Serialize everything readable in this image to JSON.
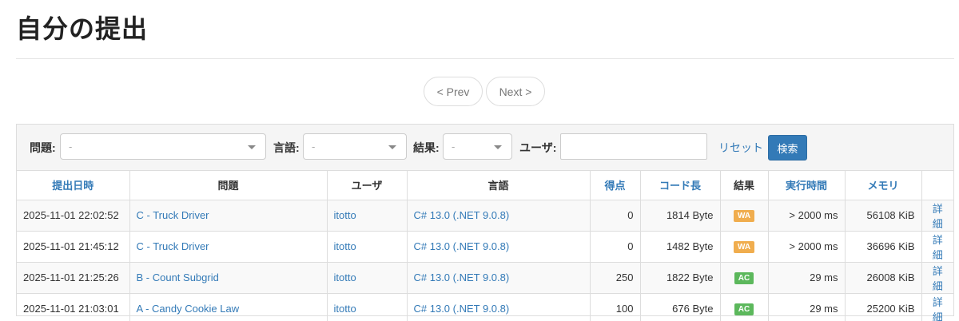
{
  "page": {
    "title": "自分の提出"
  },
  "pager": {
    "prev": "< Prev",
    "next": "Next >"
  },
  "filters": {
    "problem_label": "問題:",
    "problem_value": "-",
    "language_label": "言語:",
    "language_value": "-",
    "status_label": "結果:",
    "status_value": "-",
    "user_label": "ユーザ:",
    "user_value": "",
    "reset": "リセット",
    "search": "検索"
  },
  "table": {
    "headers": [
      "提出日時",
      "問題",
      "ユーザ",
      "言語",
      "得点",
      "コード長",
      "結果",
      "実行時間",
      "メモリ",
      ""
    ],
    "rows": [
      {
        "time": "2025-11-01 22:02:52",
        "problem": "C - Truck Driver",
        "user": "itotto",
        "language": "C# 13.0 (.NET 9.0.8)",
        "score": "0",
        "code_length": "1814 Byte",
        "status": "WA",
        "exec_time": "> 2000 ms",
        "memory": "56108 KiB",
        "detail": "詳細"
      },
      {
        "time": "2025-11-01 21:45:12",
        "problem": "C - Truck Driver",
        "user": "itotto",
        "language": "C# 13.0 (.NET 9.0.8)",
        "score": "0",
        "code_length": "1482 Byte",
        "status": "WA",
        "exec_time": "> 2000 ms",
        "memory": "36696 KiB",
        "detail": "詳細"
      },
      {
        "time": "2025-11-01 21:25:26",
        "problem": "B - Count Subgrid",
        "user": "itotto",
        "language": "C# 13.0 (.NET 9.0.8)",
        "score": "250",
        "code_length": "1822 Byte",
        "status": "AC",
        "exec_time": "29 ms",
        "memory": "26008 KiB",
        "detail": "詳細"
      },
      {
        "time": "2025-11-01 21:03:01",
        "problem": "A - Candy Cookie Law",
        "user": "itotto",
        "language": "C# 13.0 (.NET 9.0.8)",
        "score": "100",
        "code_length": "676 Byte",
        "status": "AC",
        "exec_time": "29 ms",
        "memory": "25200 KiB",
        "detail": "詳細"
      }
    ]
  },
  "colors": {
    "link": "#337ab7",
    "wa": "#f0ad4e",
    "ac": "#5cb85c"
  }
}
